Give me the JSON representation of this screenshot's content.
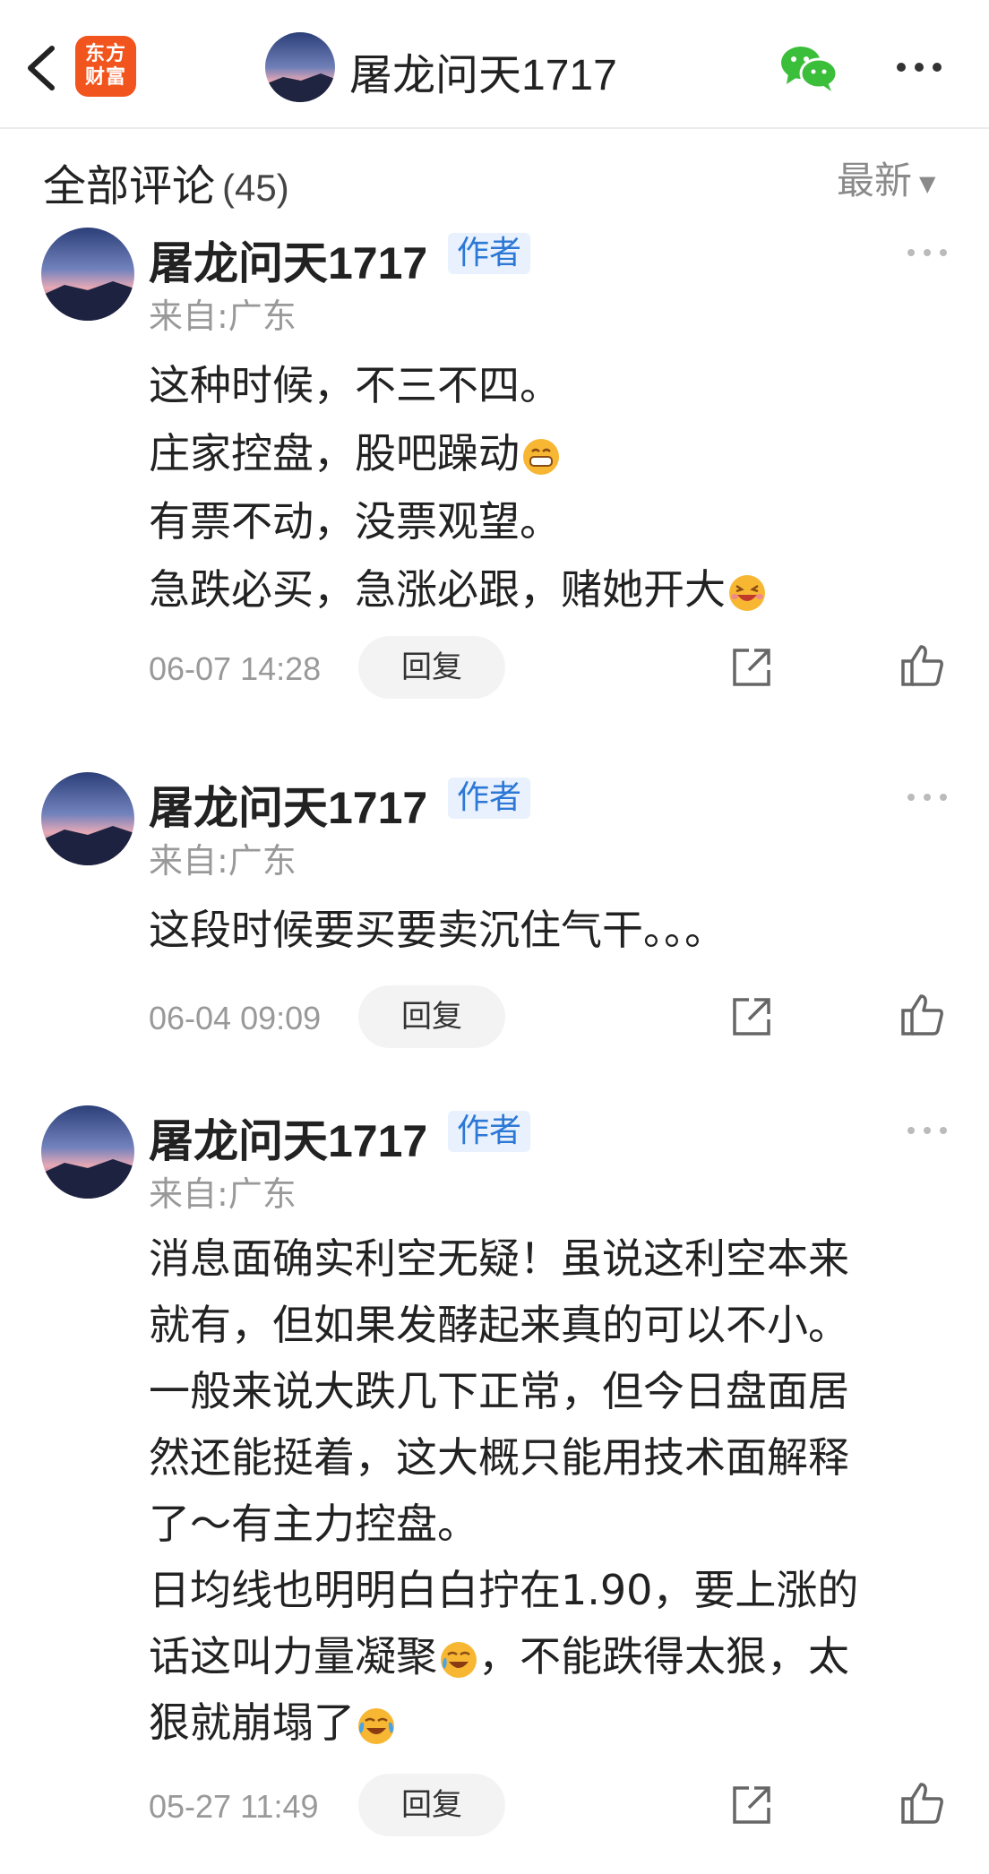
{
  "header": {
    "back_icon": "chevron-left-icon",
    "logo_line1": "东方",
    "logo_line2": "财富",
    "title": "屠龙问天1717",
    "wechat_icon": "wechat-icon",
    "more_icon": "more-horizontal-icon",
    "brand_color": "#f2541d"
  },
  "comments_header": {
    "title": "全部评论",
    "count": "(45)",
    "sort_label": "最新",
    "sort_icon": "caret-down-icon"
  },
  "comments": [
    {
      "author": "屠龙问天1717",
      "badge": "作者",
      "region": "来自:广东",
      "lines": [
        "这种时候，不三不四。",
        "庄家控盘，股吧躁动",
        "有票不动，没票观望。",
        "急跌必买，急涨必跟，赌她开大"
      ],
      "time": "06-07 14:28",
      "reply_label": "回复"
    },
    {
      "author": "屠龙问天1717",
      "badge": "作者",
      "region": "来自:广东",
      "lines": [
        "这段时候要买要卖沉住气干。。。"
      ],
      "time": "06-04 09:09",
      "reply_label": "回复"
    },
    {
      "author": "屠龙问天1717",
      "badge": "作者",
      "region": "来自:广东",
      "lines": [
        "消息面确实利空无疑！虽说这利空本来",
        "就有，但如果发酵起来真的可以不小。",
        "一般来说大跌几下正常，但今日盘面居",
        "然还能挺着，这大概只能用技术面解释",
        "了～有主力控盘。",
        "日均线也明明白白拧在1.90，要上涨的",
        "话这叫力量凝聚",
        "，不能跌得太狠，太",
        "狠就崩塌了"
      ],
      "time": "05-27 11:49",
      "reply_label": "回复"
    }
  ]
}
